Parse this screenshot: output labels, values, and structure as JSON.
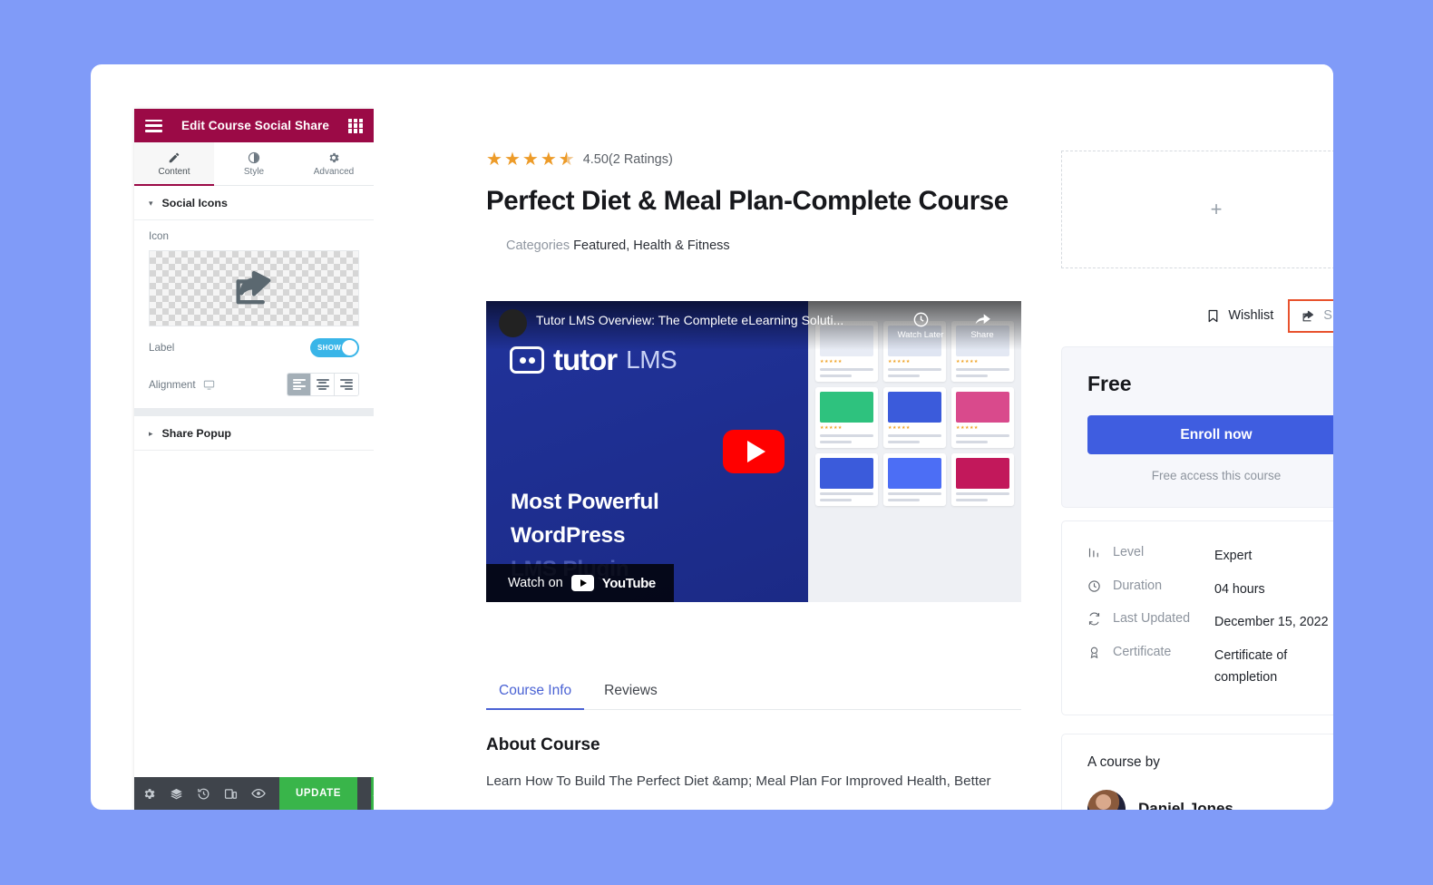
{
  "theme": {
    "background": "#809bf8",
    "panel_header_bg": "#9b0a46",
    "accent_blue": "#3f5de0",
    "selection_orange": "#e8522d",
    "update_green": "#39b54a",
    "toggle_blue": "#39b5e8"
  },
  "panel": {
    "title": "Edit Course Social Share",
    "menu_icon": "hamburger-icon",
    "widgets_icon": "widgets-grid-icon",
    "tabs": [
      {
        "label": "Content",
        "icon": "pencil-icon",
        "active": true
      },
      {
        "label": "Style",
        "icon": "contrast-icon",
        "active": false
      },
      {
        "label": "Advanced",
        "icon": "gear-icon",
        "active": false
      }
    ],
    "sections": [
      {
        "label": "Social Icons",
        "expanded": true,
        "caret": "▾"
      },
      {
        "label": "Share Popup",
        "expanded": false,
        "caret": "▸"
      }
    ],
    "controls": {
      "icon_label": "Icon",
      "icon_preview": "share-icon",
      "label_label": "Label",
      "label_toggle_text": "SHOW",
      "label_toggle_on": true,
      "alignment_label": "Alignment",
      "alignment_device_icon": "desktop-icon",
      "alignment_options": [
        "align-left",
        "align-center",
        "align-right"
      ],
      "alignment_active": "align-left"
    },
    "footer": {
      "icons": [
        "settings-gear-icon",
        "navigator-layers-icon",
        "history-icon",
        "responsive-mode-icon",
        "preview-eye-icon"
      ],
      "update_label": "UPDATE",
      "update_caret": "▲"
    },
    "collapse_icon": "chevron-left-icon"
  },
  "course": {
    "rating_value": "4.50",
    "rating_text": "4.50(2 Ratings)",
    "stars_filled": 4,
    "stars_half": 1,
    "title": "Perfect Diet & Meal Plan-Complete Course",
    "categories_label": "Categories",
    "categories_value": "Featured, Health & Fitness",
    "tabs": [
      {
        "label": "Course Info",
        "active": true
      },
      {
        "label": "Reviews",
        "active": false
      }
    ],
    "about_heading": "About Course",
    "about_body": "Learn How To Build The Perfect Diet &amp; Meal Plan For Improved Health, Better"
  },
  "video": {
    "yt_title": "Tutor LMS Overview: The Complete eLearning Soluti...",
    "watch_later_label": "Watch Later",
    "share_label": "Share",
    "brand_word": "tutor",
    "brand_sub": "LMS",
    "headline_line1": "Most Powerful",
    "headline_line2": "WordPress",
    "headline_line3": "LMS Plugin",
    "watch_on_label": "Watch on",
    "youtube_label": "YouTube",
    "play_icon": "youtube-play-icon"
  },
  "sidebar": {
    "dropzone_icon": "plus-icon",
    "wishlist_label": "Wishlist",
    "wishlist_icon": "bookmark-icon",
    "share_label": "Share",
    "share_icon": "share-icon",
    "share_selected": true,
    "price": "Free",
    "enroll_label": "Enroll now",
    "free_note": "Free access this course",
    "meta": [
      {
        "icon": "levels-bars-icon",
        "key": "Level",
        "value": "Expert"
      },
      {
        "icon": "clock-icon",
        "key": "Duration",
        "value": "04 hours"
      },
      {
        "icon": "refresh-icon",
        "key": "Last Updated",
        "value": "December 15, 2022"
      },
      {
        "icon": "certificate-icon",
        "key": "Certificate",
        "value": "Certificate of completion"
      }
    ],
    "author_heading": "A course by",
    "author_name": "Daniel Jones",
    "author_avatar": "instructor-avatar"
  }
}
